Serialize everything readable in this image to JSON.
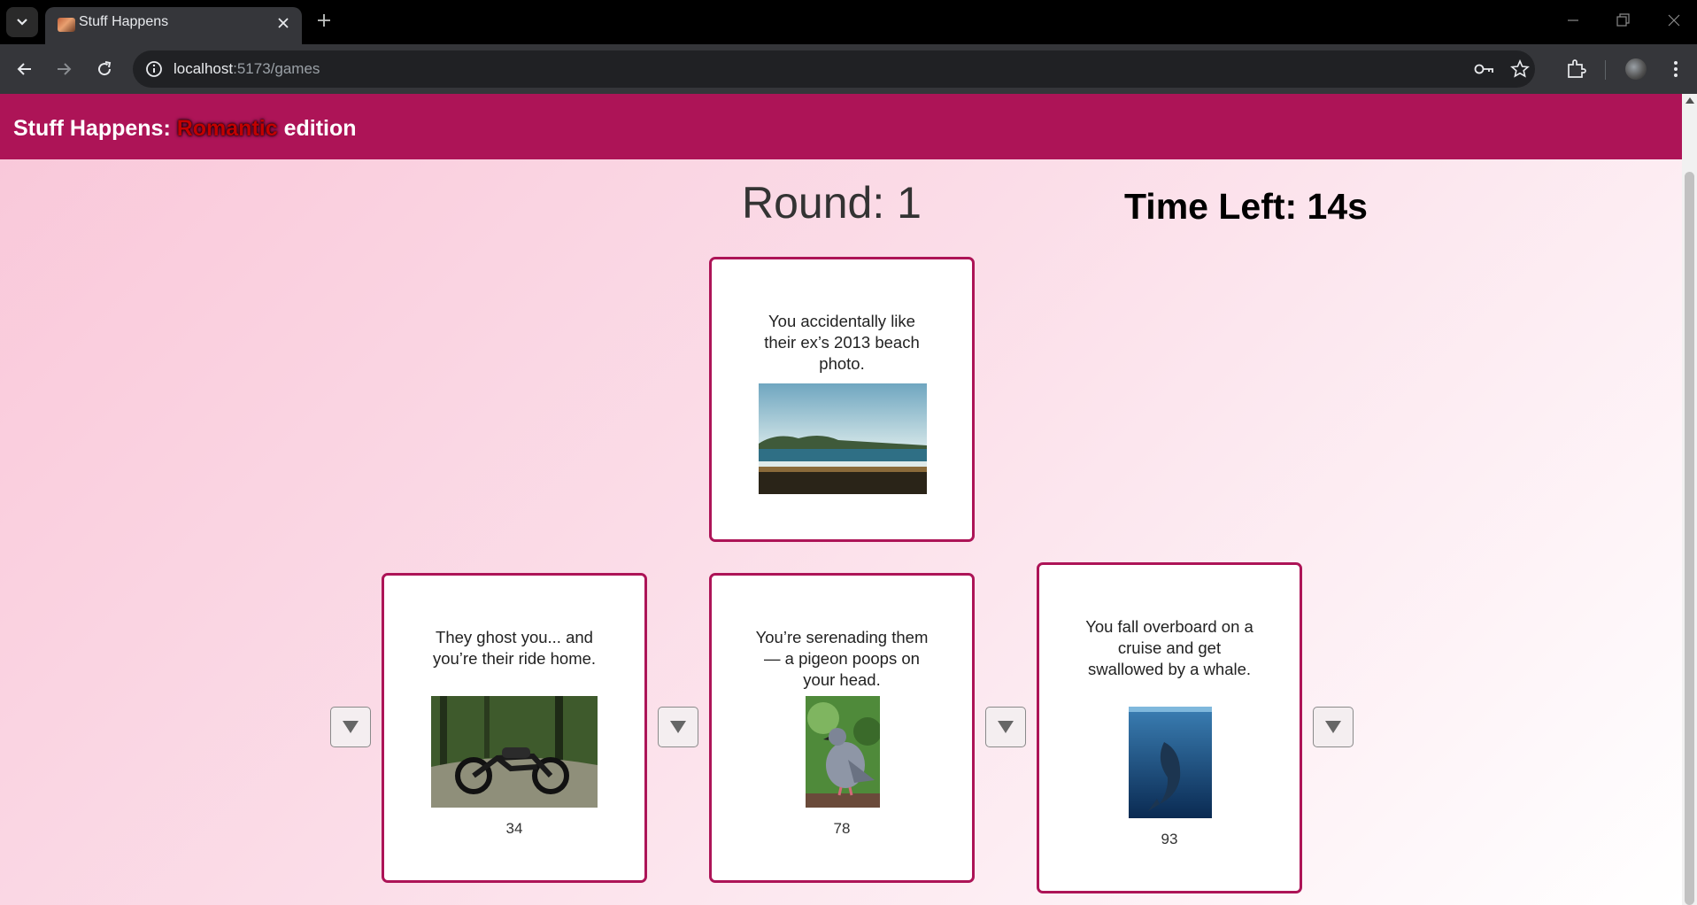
{
  "browser": {
    "tab_title": "Stuff Happens",
    "url_host": "localhost",
    "url_path": ":5173/games"
  },
  "app": {
    "title_prefix": "Stuff Happens: ",
    "title_highlight": "Romantic",
    "title_suffix": " edition",
    "colors": {
      "header": "#ad1457",
      "card_border": "#ad1457",
      "highlight": "#c20000"
    }
  },
  "game": {
    "round": "Round: 1",
    "time_left": "Time Left: 14s",
    "current_card": {
      "text": "You accidentally like their ex’s 2013 beach photo.",
      "image": "beach-photo"
    },
    "hand": [
      {
        "text": "They ghost you... and you’re their ride home.",
        "image": "motorcycle-photo",
        "value": "34"
      },
      {
        "text": "You’re serenading them — a pigeon poops on your head.",
        "image": "pigeon-photo",
        "value": "78"
      },
      {
        "text": "You fall overboard on a cruise and get swallowed by a whale.",
        "image": "whale-photo",
        "value": "93"
      }
    ],
    "drop_buttons": [
      "arrow-down-icon",
      "arrow-down-icon",
      "arrow-down-icon",
      "arrow-down-icon"
    ]
  }
}
